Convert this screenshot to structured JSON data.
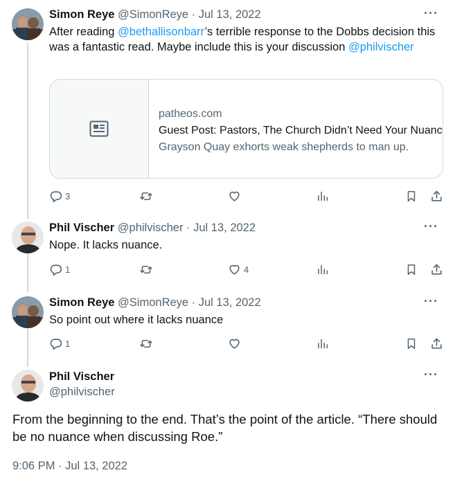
{
  "tweets": [
    {
      "name": "Simon Reye",
      "meta": "@SimonReye · Jul 13, 2022",
      "text_before": "After reading ",
      "mention1": "@bethallisonbarr",
      "text_middle": "’s terrible response to the Dobbs decision this was a fantastic read. Maybe include this is your discussion ",
      "mention2": "@philvischer",
      "card": {
        "domain": "patheos.com",
        "title": "Guest Post: Pastors, The Church Didn’t Need Your Nuance",
        "description": "Grayson Quay exhorts weak shepherds to man up."
      },
      "replies": "3",
      "retweets": "",
      "likes": ""
    },
    {
      "name": "Phil Vischer",
      "meta": "@philvischer · Jul 13, 2022",
      "text": "Nope. It lacks nuance.",
      "replies": "1",
      "retweets": "",
      "likes": "4"
    },
    {
      "name": "Simon Reye",
      "meta": "@SimonReye · Jul 13, 2022",
      "text": "So point out where it lacks nuance",
      "replies": "1",
      "retweets": "",
      "likes": ""
    }
  ],
  "main_tweet": {
    "name": "Phil Vischer",
    "handle": "@philvischer",
    "text": "From the beginning to the end. That’s the point of the article. “There should be no nuance when discussing Roe.”",
    "timestamp": "9:06 PM · Jul 13, 2022"
  },
  "more_label": "···",
  "colors": {
    "link": "#1d9bf0",
    "muted": "#536471",
    "border": "#cfd9de"
  },
  "icons": [
    "reply-icon",
    "retweet-icon",
    "like-icon",
    "views-icon",
    "bookmark-icon",
    "share-icon",
    "news-article-icon"
  ]
}
